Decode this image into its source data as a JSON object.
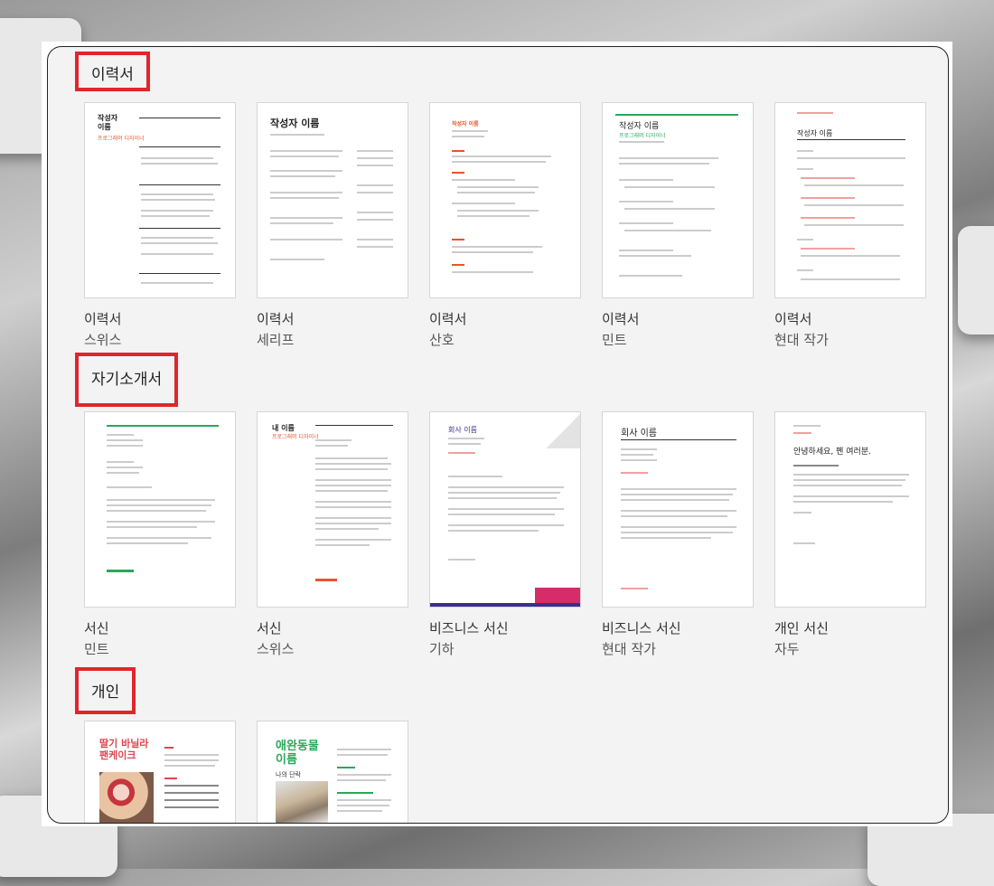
{
  "sections": [
    {
      "title": "이력서",
      "items": [
        {
          "line1": "이력서",
          "line2": "스위스",
          "preview_title": "작성자 이름",
          "preview_sub": "프로그래머 디자이너"
        },
        {
          "line1": "이력서",
          "line2": "세리프",
          "preview_title": "작성자 이름"
        },
        {
          "line1": "이력서",
          "line2": "산호",
          "preview_title": "작성자 이름"
        },
        {
          "line1": "이력서",
          "line2": "민트",
          "preview_title": "작성자 이름",
          "preview_sub": "프로그래머 디자이너"
        },
        {
          "line1": "이력서",
          "line2": "현대 작가",
          "preview_title": "작성자 이름"
        }
      ]
    },
    {
      "title": "자기소개서",
      "items": [
        {
          "line1": "서신",
          "line2": "민트"
        },
        {
          "line1": "서신",
          "line2": "스위스",
          "preview_title": "내 이름",
          "preview_sub": "프로그래머 디자이너"
        },
        {
          "line1": "비즈니스 서신",
          "line2": "기하",
          "preview_title": "회사 이름"
        },
        {
          "line1": "비즈니스 서신",
          "line2": "현대 작가",
          "preview_title": "회사 이름"
        },
        {
          "line1": "개인 서신",
          "line2": "자두",
          "preview_title": "안녕하세요, 펜 여러분."
        }
      ]
    },
    {
      "title": "개인",
      "items": [
        {
          "preview_title": "딸기 바닐라 팬케이크"
        },
        {
          "preview_title": "애완동물 이름",
          "preview_sub": "나의 단락"
        }
      ]
    }
  ],
  "colors": {
    "highlight": "#e0262c",
    "coral": "#e8542a",
    "mint": "#2aa85a",
    "geometric": "#3b2e8f"
  }
}
